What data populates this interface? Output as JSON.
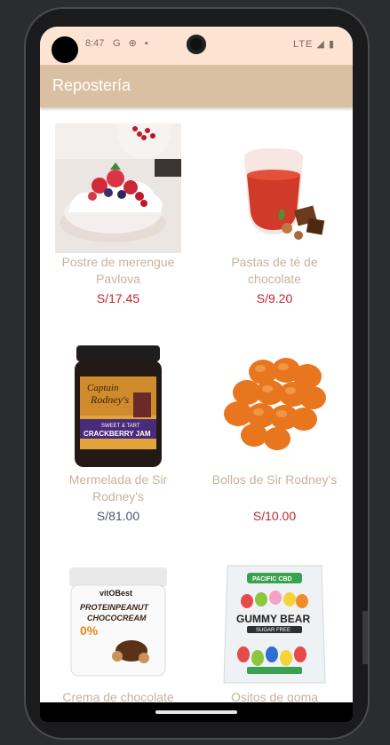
{
  "status": {
    "time": "8:47",
    "left_icons": "G ⊕ ▪",
    "network": "LTE ◢ ▮"
  },
  "appbar": {
    "title": "Repostería"
  },
  "products": [
    {
      "name": "Postre de merengue Pavlova",
      "price": "S/17.45",
      "image": "pavlova-dessert-image"
    },
    {
      "name": "Pastas de té de chocolate",
      "price": "S/9.20",
      "image": "chocolate-tea-image"
    },
    {
      "name": "Mermelada de Sir Rodney's",
      "price": "S/81.00",
      "image": "jam-jar-image"
    },
    {
      "name": "Bollos de Sir Rodney's",
      "price": "S/10.00",
      "image": "buns-image"
    },
    {
      "name": "Crema de chocolate",
      "price": "",
      "image": "protein-cream-jar-image"
    },
    {
      "name": "Ositos de goma",
      "price": "",
      "image": "gummy-bear-bag-image"
    }
  ],
  "colors": {
    "appbar": "#d9c0a0",
    "statusbar": "#fde3d2",
    "price_red": "#c0262c",
    "price_blue": "#4a5675",
    "name_tan": "#c7b39a"
  }
}
